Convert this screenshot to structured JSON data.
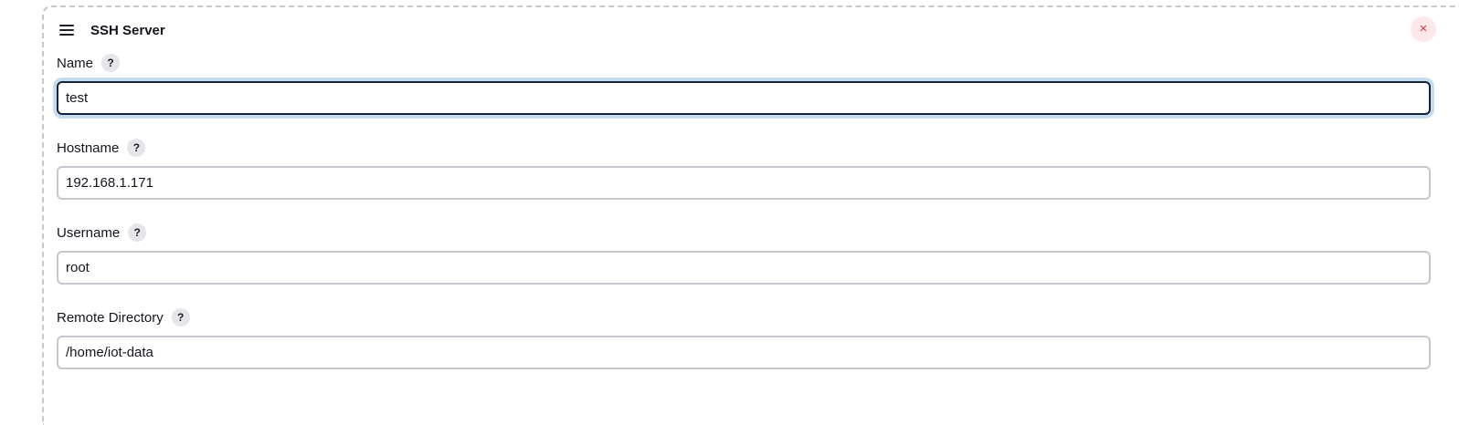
{
  "panel": {
    "title": "SSH Server",
    "menu_icon": "hamburger-icon",
    "close_icon": "close-icon",
    "close_glyph": "×"
  },
  "fields": [
    {
      "label": "Name",
      "value": "test",
      "help": "?"
    },
    {
      "label": "Hostname",
      "value": "192.168.1.171",
      "help": "?"
    },
    {
      "label": "Username",
      "value": "root",
      "help": "?"
    },
    {
      "label": "Remote Directory",
      "value": "/home/iot-data",
      "help": "?"
    }
  ],
  "colors": {
    "focus_border": "#14213d",
    "focus_ring": "#c5dced",
    "close_red": "#e0303c"
  }
}
